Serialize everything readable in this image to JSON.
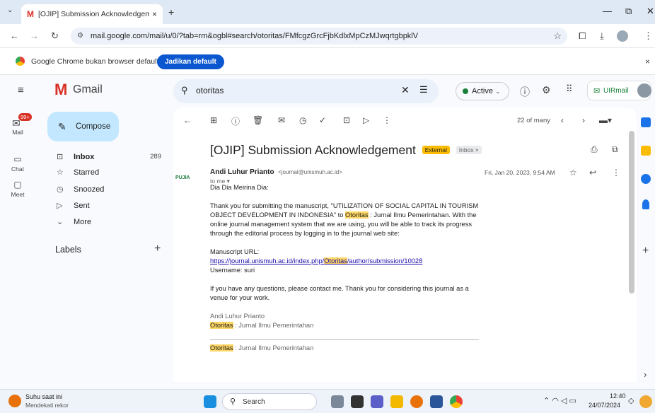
{
  "browser": {
    "tab_title": "[OJIP] Submission Acknowledgeme",
    "tab_close": "×",
    "new_tab": "+",
    "url": "mail.google.com/mail/u/0/?tab=rm&ogbl#search/otoritas/FMfcgzGrcFjbKdlxMpCzMJwqrtgbpklV",
    "default_notice": "Google Chrome bukan browser default",
    "default_button": "Jadikan default",
    "close_notice": "×"
  },
  "gmail": {
    "logo_text": "Gmail",
    "search_query": "otoritas",
    "status": "Active",
    "account_label": "UIRmail"
  },
  "rail": {
    "mail_badge": "99+",
    "mail": "Mail",
    "chat": "Chat",
    "meet": "Meet"
  },
  "nav": {
    "compose": "Compose",
    "items": [
      {
        "label": "Inbox",
        "count": "289"
      },
      {
        "label": "Starred",
        "count": ""
      },
      {
        "label": "Snoozed",
        "count": ""
      },
      {
        "label": "Sent",
        "count": ""
      },
      {
        "label": "More",
        "count": ""
      }
    ],
    "labels_heading": "Labels",
    "labels_add": "+"
  },
  "message": {
    "pagination": "22 of many",
    "subject": "[OJIP] Submission Acknowledgement",
    "tag_external": "External",
    "tag_inbox": "Inbox ×",
    "sender_name": "Andi Luhur Prianto",
    "sender_email": "<journal@unismuh.ac.id>",
    "to": "to me ▾",
    "date": "Fri, Jan 20, 2023, 9:54 AM",
    "avatar_text": "PUJIA",
    "greeting": "Dia Dia Meirina Dia:",
    "para1_a": "Thank you for submitting the manuscript, \"UTILIZATION OF SOCIAL CAPITAL IN TOURISM OBJECT DEVELOPMENT IN INDONESIA\" to ",
    "para1_hl": "Otoritas",
    "para1_b": " : Jurnal Ilmu Pemerintahan. With the online journal management system that we are using, you will be able to track its progress through the editorial process by logging in to the journal web site:",
    "manuscript_label": "Manuscript URL:",
    "url_a": "https://journal.unismuh.ac.id/index.php/",
    "url_hl": "Otoritas",
    "url_b": "/author/submission/10028",
    "username": "Username: suri",
    "para2": "If you have any questions, please contact me. Thank you for considering this journal as a venue for your work.",
    "sig_name": "Andi Luhur Prianto",
    "sig_hl": "Otoritas",
    "sig_journal": " : Jurnal Ilmu Pemerintahan",
    "footer_hl": "Otoritas",
    "footer_journal": " : Jurnal Ilmu Pemerintahan"
  },
  "taskbar": {
    "weather_title": "Suhu saat ini",
    "weather_sub": "Mendekati rekor",
    "search": "Search",
    "time": "12:40",
    "date": "24/07/2024"
  }
}
